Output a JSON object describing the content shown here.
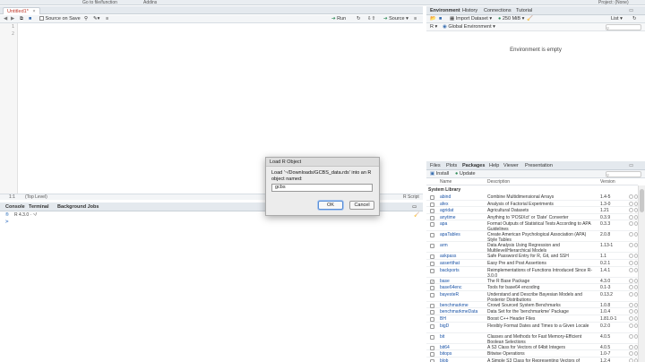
{
  "app": {
    "top_bar_left": "Go to file/function",
    "top_bar_addins": "Addins",
    "project": "Project: (None)"
  },
  "editor": {
    "tab_label": "Untitled1*",
    "source_on_save": "Source on Save",
    "run": "Run",
    "source": "Source",
    "line_numbers": [
      "1",
      "2"
    ],
    "status_pos": "1:1",
    "status_scope": "(Top Level)",
    "status_type": "R Script"
  },
  "console": {
    "tabs": [
      "Console",
      "Terminal",
      "Background Jobs"
    ],
    "version_line": "R 4.3.0 · ~/",
    "prompt": ">"
  },
  "environment": {
    "tabs": [
      "Environment",
      "History",
      "Connections",
      "Tutorial"
    ],
    "import_dataset": "Import Dataset",
    "memory": "250 MiB",
    "view_mode": "List",
    "language": "R",
    "scope": "Global Environment",
    "empty_message": "Environment is empty"
  },
  "packages": {
    "tabs": [
      "Files",
      "Plots",
      "Packages",
      "Help",
      "Viewer",
      "Presentation"
    ],
    "install": "Install",
    "update": "Update",
    "headers": {
      "name": "Name",
      "description": "Description",
      "version": "Version"
    },
    "section": "System Library",
    "rows": [
      {
        "name": "abind",
        "desc": "Combine Multidimensional Arrays",
        "version": "1.4-5",
        "checked": false
      },
      {
        "name": "afex",
        "desc": "Analysis of Factorial Experiments",
        "version": "1.3-0",
        "checked": false
      },
      {
        "name": "agridat",
        "desc": "Agricultural Datasets",
        "version": "1.21",
        "checked": false
      },
      {
        "name": "anytime",
        "desc": "Anything to 'POSIXct' or 'Date' Converter",
        "version": "0.3.9",
        "checked": false
      },
      {
        "name": "apa",
        "desc": "Format Outputs of Statistical Tests According to APA Guidelines",
        "version": "0.3.3",
        "checked": false
      },
      {
        "name": "apaTables",
        "desc": "Create American Psychological Association (APA) Style Tables",
        "version": "2.0.8",
        "checked": false
      },
      {
        "name": "arm",
        "desc": "Data Analysis Using Regression and Multilevel/Hierarchical Models",
        "version": "1.13-1",
        "checked": false
      },
      {
        "name": "askpass",
        "desc": "Safe Password Entry for R, Git, and SSH",
        "version": "1.1",
        "checked": false
      },
      {
        "name": "assertthat",
        "desc": "Easy Pre and Post Assertions",
        "version": "0.2.1",
        "checked": false
      },
      {
        "name": "backports",
        "desc": "Reimplementations of Functions Introduced Since R-3.0.0",
        "version": "1.4.1",
        "checked": false
      },
      {
        "name": "base",
        "desc": "The R Base Package",
        "version": "4.3.0",
        "checked": true
      },
      {
        "name": "base64enc",
        "desc": "Tools for base64 encoding",
        "version": "0.1-3",
        "checked": false
      },
      {
        "name": "bayesteR",
        "desc": "Understand and Describe Bayesian Models and Posterior Distributions",
        "version": "0.13.2",
        "checked": false
      },
      {
        "name": "benchmarkme",
        "desc": "Crowd Sourced System Benchmarks",
        "version": "1.0.8",
        "checked": false
      },
      {
        "name": "benchmarkmeData",
        "desc": "Data Set for the 'benchmarkme' Package",
        "version": "1.0.4",
        "checked": false
      },
      {
        "name": "BH",
        "desc": "Boost C++ Header Files",
        "version": "1.81.0-1",
        "checked": false
      },
      {
        "name": "bigD",
        "desc": "Flexibly Format Dates and Times to a Given Locale",
        "version": "0.2.0",
        "checked": false
      },
      {
        "name": "bit",
        "desc": "Classes and Methods for Fast Memory-Efficient Boolean Selections",
        "version": "4.0.5",
        "checked": false
      },
      {
        "name": "bit64",
        "desc": "A S3 Class for Vectors of 64bit Integers",
        "version": "4.0.5",
        "checked": false
      },
      {
        "name": "bitops",
        "desc": "Bitwise Operations",
        "version": "1.0-7",
        "checked": false
      },
      {
        "name": "blob",
        "desc": "A Simple S3 Class for Representing Vectors of",
        "version": "1.2.4",
        "checked": false
      }
    ]
  },
  "dialog": {
    "title": "Load R Object",
    "message": "Load '~/Downloads/GCBS_data.rds' into an R object named:",
    "input_value": "gcbs",
    "ok": "OK",
    "cancel": "Cancel"
  }
}
